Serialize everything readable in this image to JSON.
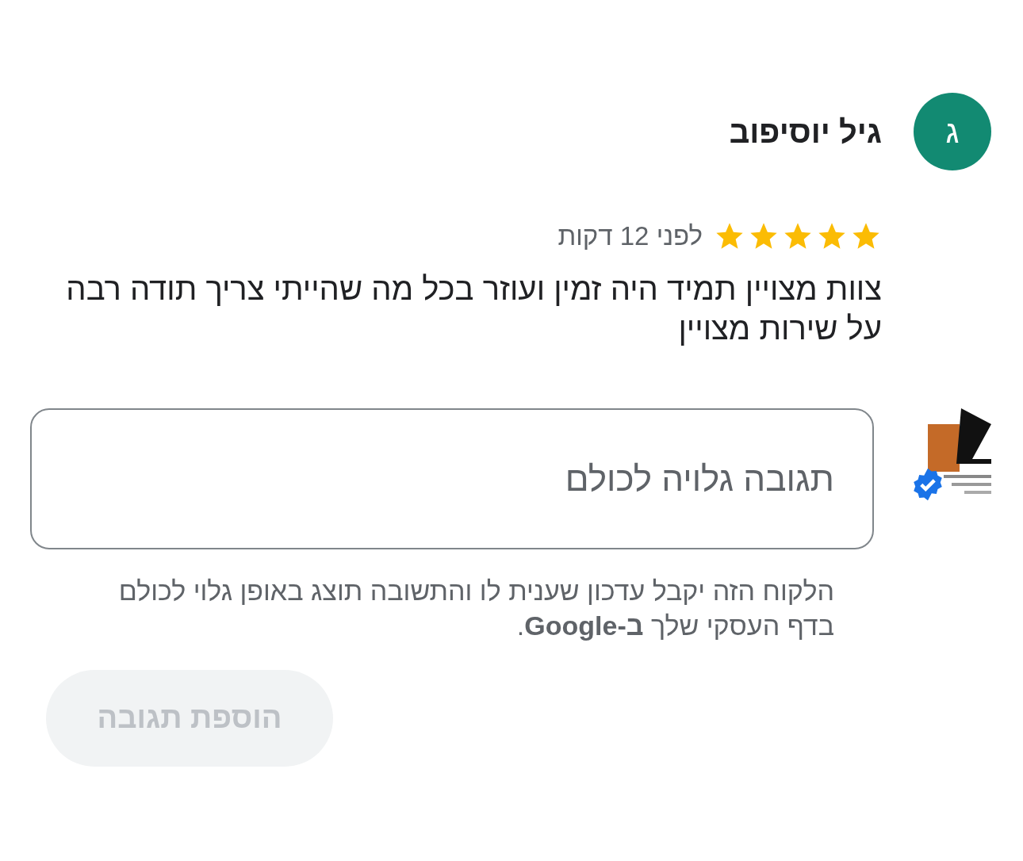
{
  "reviewer": {
    "initial": "ג",
    "name": "גיל יוסיפוב"
  },
  "review": {
    "stars": 5,
    "time": "לפני 12 דקות",
    "text": "צוות מצויין תמיד היה זמין ועוזר בכל מה שהייתי צריך תודה רבה על שירות מצויין"
  },
  "reply": {
    "verified": true,
    "placeholder": "תגובה גלויה לכולם",
    "note": "הלקוח הזה יקבל עדכון שענית לו והתשובה תוצג באופן גלוי לכולם בדף העסקי שלך **ב-Google**.",
    "button": {
      "label": "הוספת תגובה",
      "disabled": true
    }
  }
}
